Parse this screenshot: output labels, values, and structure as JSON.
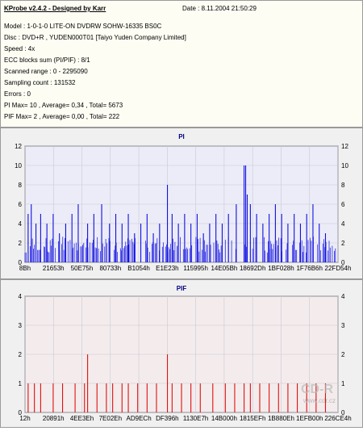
{
  "header": {
    "title": "KProbe v2.4.2 - Designed by Karr",
    "date": "Date : 8.11.2004 21:50:29"
  },
  "info_lines": [
    "Model : 1-0-1-0 LITE-ON DVDRW SOHW-16335 BS0C",
    "Disc : DVD+R , YUDEN000T01 [Taiyo Yuden Company Limited]",
    "Speed : 4x",
    "ECC blocks sum (PI/PIF) : 8/1",
    "Scanned range : 0 - 2295090",
    "Sampling count : 131532",
    "Errors : 0",
    "PI Max= 10 , Average= 0,34 , Total= 5673",
    "PIF Max= 2 , Average= 0,00 , Total= 222"
  ],
  "watermark": {
    "text": "CD-R",
    "url": "www.cdr.cz"
  },
  "chart_data": [
    {
      "type": "bar",
      "title": "PI",
      "xlabel": "",
      "ylabel": "",
      "ylim": [
        0,
        12
      ],
      "y_ticks": [
        "0",
        "2",
        "4",
        "6",
        "8",
        "10",
        "12"
      ],
      "x_ticks": [
        "8Bh",
        "21653h",
        "50E75h",
        "80733h",
        "B1054h",
        "E1E23h",
        "115995h",
        "14E05Bh",
        "18692Dh",
        "1BF028h",
        "1F76B6h",
        "22FD54h"
      ],
      "grid": true,
      "color": "#1010e0",
      "background": "#ececf8",
      "spikes": [
        {
          "x": 0.01,
          "value": 5
        },
        {
          "x": 0.02,
          "value": 6
        },
        {
          "x": 0.035,
          "value": 4
        },
        {
          "x": 0.05,
          "value": 5
        },
        {
          "x": 0.07,
          "value": 4
        },
        {
          "x": 0.09,
          "value": 5
        },
        {
          "x": 0.11,
          "value": 3
        },
        {
          "x": 0.13,
          "value": 4
        },
        {
          "x": 0.15,
          "value": 5
        },
        {
          "x": 0.17,
          "value": 6
        },
        {
          "x": 0.2,
          "value": 4
        },
        {
          "x": 0.22,
          "value": 5
        },
        {
          "x": 0.245,
          "value": 6
        },
        {
          "x": 0.27,
          "value": 4
        },
        {
          "x": 0.29,
          "value": 5
        },
        {
          "x": 0.31,
          "value": 4
        },
        {
          "x": 0.33,
          "value": 5
        },
        {
          "x": 0.35,
          "value": 3
        },
        {
          "x": 0.37,
          "value": 4
        },
        {
          "x": 0.39,
          "value": 5
        },
        {
          "x": 0.41,
          "value": 3
        },
        {
          "x": 0.43,
          "value": 4
        },
        {
          "x": 0.455,
          "value": 8
        },
        {
          "x": 0.47,
          "value": 5
        },
        {
          "x": 0.49,
          "value": 4
        },
        {
          "x": 0.51,
          "value": 5
        },
        {
          "x": 0.53,
          "value": 4
        },
        {
          "x": 0.55,
          "value": 5
        },
        {
          "x": 0.57,
          "value": 3
        },
        {
          "x": 0.59,
          "value": 4
        },
        {
          "x": 0.61,
          "value": 5
        },
        {
          "x": 0.63,
          "value": 4
        },
        {
          "x": 0.65,
          "value": 5
        },
        {
          "x": 0.675,
          "value": 6
        },
        {
          "x": 0.7,
          "value": 10
        },
        {
          "x": 0.705,
          "value": 10
        },
        {
          "x": 0.71,
          "value": 7
        },
        {
          "x": 0.72,
          "value": 6
        },
        {
          "x": 0.74,
          "value": 5
        },
        {
          "x": 0.76,
          "value": 4
        },
        {
          "x": 0.78,
          "value": 5
        },
        {
          "x": 0.8,
          "value": 6
        },
        {
          "x": 0.82,
          "value": 5
        },
        {
          "x": 0.84,
          "value": 4
        },
        {
          "x": 0.86,
          "value": 5
        },
        {
          "x": 0.88,
          "value": 4
        },
        {
          "x": 0.9,
          "value": 5
        },
        {
          "x": 0.92,
          "value": 6
        },
        {
          "x": 0.94,
          "value": 4
        },
        {
          "x": 0.96,
          "value": 3
        }
      ]
    },
    {
      "type": "bar",
      "title": "PIF",
      "xlabel": "",
      "ylabel": "",
      "ylim": [
        0,
        4
      ],
      "y_ticks": [
        "0",
        "1",
        "2",
        "3",
        "4"
      ],
      "x_ticks": [
        "12h",
        "20891h",
        "4EE3Eh",
        "7E02Eh",
        "AD9ECh",
        "DF396h",
        "1130E7h",
        "14B000h",
        "1815EFh",
        "1B880Eh",
        "1EFB00h",
        "226CE4h"
      ],
      "grid": true,
      "color": "#e01010",
      "background": "#f4ecec",
      "spikes": [
        {
          "x": 0.01,
          "value": 1
        },
        {
          "x": 0.03,
          "value": 1
        },
        {
          "x": 0.05,
          "value": 1
        },
        {
          "x": 0.09,
          "value": 1
        },
        {
          "x": 0.12,
          "value": 1
        },
        {
          "x": 0.16,
          "value": 1
        },
        {
          "x": 0.19,
          "value": 1
        },
        {
          "x": 0.2,
          "value": 2
        },
        {
          "x": 0.23,
          "value": 1
        },
        {
          "x": 0.26,
          "value": 1
        },
        {
          "x": 0.28,
          "value": 1
        },
        {
          "x": 0.31,
          "value": 1
        },
        {
          "x": 0.33,
          "value": 1
        },
        {
          "x": 0.36,
          "value": 1
        },
        {
          "x": 0.39,
          "value": 1
        },
        {
          "x": 0.42,
          "value": 1
        },
        {
          "x": 0.455,
          "value": 2
        },
        {
          "x": 0.47,
          "value": 1
        },
        {
          "x": 0.5,
          "value": 1
        },
        {
          "x": 0.53,
          "value": 1
        },
        {
          "x": 0.56,
          "value": 1
        },
        {
          "x": 0.6,
          "value": 1
        },
        {
          "x": 0.64,
          "value": 1
        },
        {
          "x": 0.67,
          "value": 1
        },
        {
          "x": 0.7,
          "value": 1
        },
        {
          "x": 0.72,
          "value": 1
        },
        {
          "x": 0.75,
          "value": 1
        },
        {
          "x": 0.78,
          "value": 1
        },
        {
          "x": 0.81,
          "value": 1
        },
        {
          "x": 0.84,
          "value": 1
        },
        {
          "x": 0.87,
          "value": 1
        },
        {
          "x": 0.9,
          "value": 1
        },
        {
          "x": 0.93,
          "value": 1
        },
        {
          "x": 0.96,
          "value": 1
        }
      ]
    }
  ]
}
